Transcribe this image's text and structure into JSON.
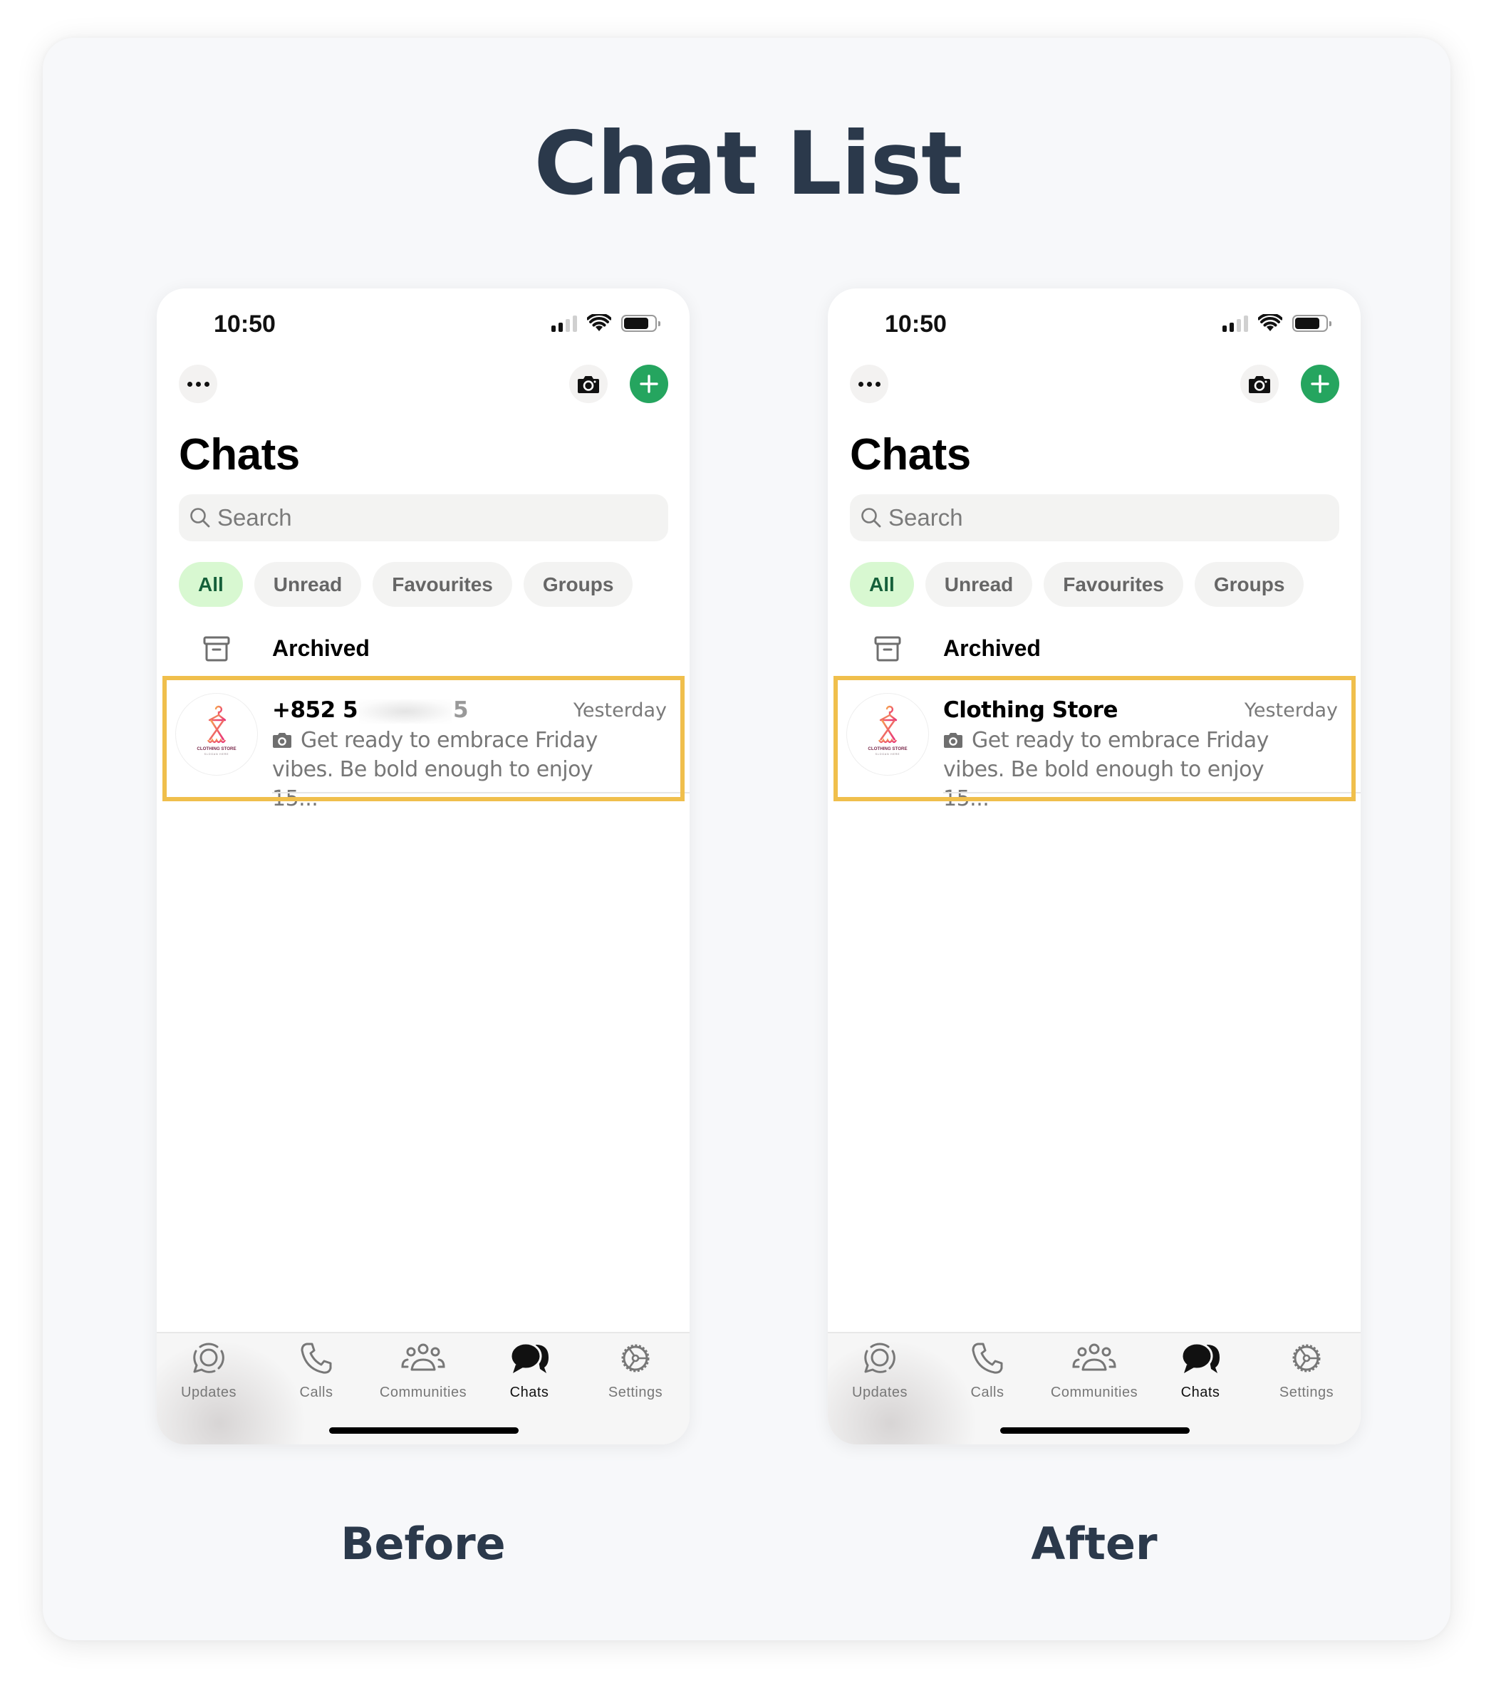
{
  "title": "Chat List",
  "captions": {
    "before": "Before",
    "after": "After"
  },
  "colors": {
    "accent_green": "#25a55f",
    "highlight": "#f0bf4c",
    "title": "#2b394b",
    "chip_active_bg": "#d8f8d1",
    "chip_active_text": "#15603a"
  },
  "screens": {
    "before": {
      "status": {
        "time": "10:50",
        "signal_bars_active": 2,
        "signal_bars_total": 4,
        "battery_percent": 80
      },
      "header": {
        "title": "Chats",
        "more_icon": "ellipsis-icon",
        "camera_icon": "camera-icon",
        "new_chat_icon": "plus-icon"
      },
      "search": {
        "placeholder": "Search",
        "value": ""
      },
      "filters": [
        {
          "label": "All",
          "active": true
        },
        {
          "label": "Unread",
          "active": false
        },
        {
          "label": "Favourites",
          "active": false
        },
        {
          "label": "Groups",
          "active": false
        }
      ],
      "archived": {
        "label": "Archived"
      },
      "chats": [
        {
          "name_prefix": "+852 5",
          "name_suffix": "5",
          "name_redacted": true,
          "time": "Yesterday",
          "preview": "Get ready to embrace Friday vibes. Be bold enough to enjoy 15...",
          "preview_icon": "camera-icon",
          "avatar": {
            "brand": "CLOTHING STORE",
            "slogan": "SLOGAN HERE"
          }
        }
      ],
      "tabs": [
        {
          "label": "Updates",
          "icon": "updates-icon",
          "active": false
        },
        {
          "label": "Calls",
          "icon": "phone-icon",
          "active": false
        },
        {
          "label": "Communities",
          "icon": "communities-icon",
          "active": false
        },
        {
          "label": "Chats",
          "icon": "chats-icon",
          "active": true
        },
        {
          "label": "Settings",
          "icon": "settings-gear-icon",
          "active": false
        }
      ]
    },
    "after": {
      "status": {
        "time": "10:50",
        "signal_bars_active": 2,
        "signal_bars_total": 4,
        "battery_percent": 80
      },
      "header": {
        "title": "Chats",
        "more_icon": "ellipsis-icon",
        "camera_icon": "camera-icon",
        "new_chat_icon": "plus-icon"
      },
      "search": {
        "placeholder": "Search",
        "value": ""
      },
      "filters": [
        {
          "label": "All",
          "active": true
        },
        {
          "label": "Unread",
          "active": false
        },
        {
          "label": "Favourites",
          "active": false
        },
        {
          "label": "Groups",
          "active": false
        }
      ],
      "archived": {
        "label": "Archived"
      },
      "chats": [
        {
          "name": "Clothing Store",
          "time": "Yesterday",
          "preview": "Get ready to embrace Friday vibes. Be bold enough to enjoy 15...",
          "preview_icon": "camera-icon",
          "avatar": {
            "brand": "CLOTHING STORE",
            "slogan": "SLOGAN HERE"
          }
        }
      ],
      "tabs": [
        {
          "label": "Updates",
          "icon": "updates-icon",
          "active": false
        },
        {
          "label": "Calls",
          "icon": "phone-icon",
          "active": false
        },
        {
          "label": "Communities",
          "icon": "communities-icon",
          "active": false
        },
        {
          "label": "Chats",
          "icon": "chats-icon",
          "active": true
        },
        {
          "label": "Settings",
          "icon": "settings-gear-icon",
          "active": false
        }
      ]
    }
  }
}
